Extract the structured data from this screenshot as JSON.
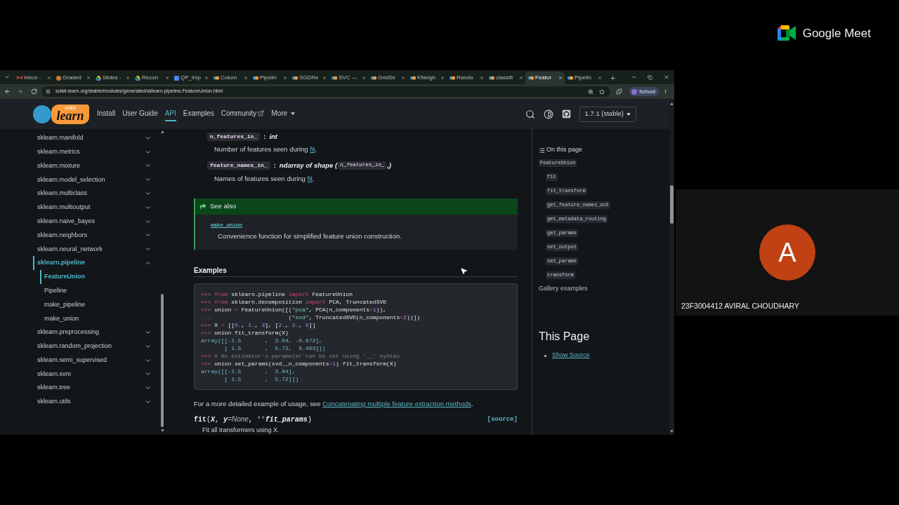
{
  "browser": {
    "tabs": [
      {
        "title": "Inbox -",
        "kind": "mail",
        "selected": false
      },
      {
        "title": "Graded",
        "kind": "circle",
        "selected": false
      },
      {
        "title": "Slides -",
        "kind": "drive",
        "selected": false
      },
      {
        "title": "Recon",
        "kind": "drive",
        "selected": false
      },
      {
        "title": "QP_imp",
        "kind": "doc",
        "selected": false
      },
      {
        "title": "Colum",
        "kind": "site",
        "selected": false
      },
      {
        "title": "Pipelin",
        "kind": "site",
        "selected": false
      },
      {
        "title": "SGDRe",
        "kind": "site",
        "selected": false
      },
      {
        "title": "SVC —",
        "kind": "site",
        "selected": false
      },
      {
        "title": "GridSe",
        "kind": "site",
        "selected": false
      },
      {
        "title": "KNeigh",
        "kind": "site",
        "selected": false
      },
      {
        "title": "Rando",
        "kind": "site",
        "selected": false
      },
      {
        "title": "classifi",
        "kind": "site",
        "selected": false
      },
      {
        "title": "Featur",
        "kind": "site",
        "selected": true
      },
      {
        "title": "Pipelin",
        "kind": "site",
        "selected": false
      }
    ],
    "url": "scikit-learn.org/stable/modules/generated/sklearn.pipeline.FeatureUnion.html",
    "profile": "School"
  },
  "header": {
    "logo": {
      "small": "scikit",
      "main": "learn"
    },
    "nav": [
      {
        "label": "Install",
        "kind": "link",
        "selected": false
      },
      {
        "label": "User Guide",
        "kind": "link",
        "selected": false
      },
      {
        "label": "API",
        "kind": "link",
        "selected": true
      },
      {
        "label": "Examples",
        "kind": "link",
        "selected": false
      },
      {
        "label": "Community",
        "kind": "external",
        "selected": false
      },
      {
        "label": "More",
        "kind": "menu",
        "selected": false
      }
    ],
    "version": "1.7.1 (stable)"
  },
  "sidebar": {
    "items": [
      {
        "label": "sklearn.manifold",
        "expanded": false,
        "selected": false
      },
      {
        "label": "sklearn.metrics",
        "expanded": false,
        "selected": false
      },
      {
        "label": "sklearn.mixture",
        "expanded": false,
        "selected": false
      },
      {
        "label": "sklearn.model_selection",
        "expanded": false,
        "selected": false
      },
      {
        "label": "sklearn.multiclass",
        "expanded": false,
        "selected": false
      },
      {
        "label": "sklearn.multioutput",
        "expanded": false,
        "selected": false
      },
      {
        "label": "sklearn.naive_bayes",
        "expanded": false,
        "selected": false
      },
      {
        "label": "sklearn.neighbors",
        "expanded": false,
        "selected": false
      },
      {
        "label": "sklearn.neural_network",
        "expanded": false,
        "selected": false
      },
      {
        "label": "sklearn.pipeline",
        "expanded": true,
        "selected": true,
        "children": [
          {
            "label": "FeatureUnion",
            "selected": true
          },
          {
            "label": "Pipeline",
            "selected": false
          },
          {
            "label": "make_pipeline",
            "selected": false
          },
          {
            "label": "make_union",
            "selected": false
          }
        ]
      },
      {
        "label": "sklearn.preprocessing",
        "expanded": false,
        "selected": false
      },
      {
        "label": "sklearn.random_projection",
        "expanded": false,
        "selected": false
      },
      {
        "label": "sklearn.semi_supervised",
        "expanded": false,
        "selected": false
      },
      {
        "label": "sklearn.svm",
        "expanded": false,
        "selected": false
      },
      {
        "label": "sklearn.tree",
        "expanded": false,
        "selected": false
      },
      {
        "label": "sklearn.utils",
        "expanded": false,
        "selected": false
      }
    ]
  },
  "content": {
    "attributes": [
      {
        "name": "n_features_in_",
        "separator": ":",
        "type": [
          {
            "kind": "text",
            "text": "int"
          }
        ],
        "description": {
          "before": "Number of features seen during ",
          "link": "fit",
          "after": "."
        }
      },
      {
        "name": "feature_names_in_",
        "separator": ":",
        "type": [
          {
            "kind": "text",
            "text": "ndarray of shape ("
          },
          {
            "kind": "code",
            "text": "n_features_in_"
          },
          {
            "kind": "text",
            "text": ",)"
          }
        ],
        "description": {
          "before": "Names of features seen during ",
          "link": "fit",
          "after": "."
        }
      }
    ],
    "see_also": {
      "title": "See also",
      "link": "make_union",
      "description": "Convenience function for simplified feature union construction."
    },
    "examples": {
      "heading": "Examples",
      "code": [
        [
          {
            "kind": "prompt",
            "text": ">>> "
          },
          {
            "kind": "keyword",
            "text": "from"
          },
          {
            "kind": "name",
            "text": " sklearn.pipeline "
          },
          {
            "kind": "keyword",
            "text": "import"
          },
          {
            "kind": "name",
            "text": " FeatureUnion"
          }
        ],
        [
          {
            "kind": "prompt",
            "text": ">>> "
          },
          {
            "kind": "keyword",
            "text": "from"
          },
          {
            "kind": "name",
            "text": " sklearn.decomposition "
          },
          {
            "kind": "keyword",
            "text": "import"
          },
          {
            "kind": "name",
            "text": " PCA, TruncatedSVD"
          }
        ],
        [
          {
            "kind": "prompt",
            "text": ">>> "
          },
          {
            "kind": "name",
            "text": "union "
          },
          {
            "kind": "op",
            "text": "="
          },
          {
            "kind": "name",
            "text": " FeatureUnion([("
          },
          {
            "kind": "string",
            "text": "\"pca\""
          },
          {
            "kind": "name",
            "text": ", PCA(n_components"
          },
          {
            "kind": "op",
            "text": "="
          },
          {
            "kind": "number",
            "text": "1"
          },
          {
            "kind": "name",
            "text": ")),"
          }
        ],
        [
          {
            "kind": "prompt",
            "text": "..."
          },
          {
            "kind": "name",
            "text": "                       ("
          },
          {
            "kind": "string",
            "text": "\"svd\""
          },
          {
            "kind": "name",
            "text": ", TruncatedSVD(n_components"
          },
          {
            "kind": "op",
            "text": "="
          },
          {
            "kind": "number",
            "text": "2"
          },
          {
            "kind": "name",
            "text": "))])"
          }
        ],
        [
          {
            "kind": "prompt",
            "text": ">>> "
          },
          {
            "kind": "name",
            "text": "X "
          },
          {
            "kind": "op",
            "text": "="
          },
          {
            "kind": "name",
            "text": " [["
          },
          {
            "kind": "number",
            "text": "0."
          },
          {
            "kind": "name",
            "text": ", "
          },
          {
            "kind": "number",
            "text": "1."
          },
          {
            "kind": "name",
            "text": ", "
          },
          {
            "kind": "number",
            "text": "3"
          },
          {
            "kind": "name",
            "text": "], ["
          },
          {
            "kind": "number",
            "text": "2."
          },
          {
            "kind": "name",
            "text": ", "
          },
          {
            "kind": "number",
            "text": "2."
          },
          {
            "kind": "name",
            "text": ", "
          },
          {
            "kind": "number",
            "text": "5"
          },
          {
            "kind": "name",
            "text": "]]"
          }
        ],
        [
          {
            "kind": "prompt",
            "text": ">>> "
          },
          {
            "kind": "name",
            "text": "union"
          },
          {
            "kind": "op",
            "text": "."
          },
          {
            "kind": "name",
            "text": "fit_transform(X)"
          }
        ],
        [
          {
            "kind": "output",
            "text": "array([[-1.5       ,  3.04, -0.872],"
          }
        ],
        [
          {
            "kind": "output",
            "text": "       [ 1.5       ,  5.72,  0.463]])"
          }
        ],
        [
          {
            "kind": "prompt",
            "text": ">>> "
          },
          {
            "kind": "comment",
            "text": "# An estimator's parameter can be set using '__' syntax"
          }
        ],
        [
          {
            "kind": "prompt",
            "text": ">>> "
          },
          {
            "kind": "name",
            "text": "union"
          },
          {
            "kind": "op",
            "text": "."
          },
          {
            "kind": "name",
            "text": "set_params(svd__n_components"
          },
          {
            "kind": "op",
            "text": "="
          },
          {
            "kind": "number",
            "text": "1"
          },
          {
            "kind": "name",
            "text": ")"
          },
          {
            "kind": "op",
            "text": "."
          },
          {
            "kind": "name",
            "text": "fit_transform(X)"
          }
        ],
        [
          {
            "kind": "output",
            "text": "array([[-1.5       ,  3.04],"
          }
        ],
        [
          {
            "kind": "output",
            "text": "       [ 1.5       ,  5.72]])"
          }
        ]
      ]
    },
    "usage": {
      "before": "For a more detailed example of usage, see ",
      "link": "Concatenating multiple feature extraction methods",
      "after": "."
    },
    "method": {
      "signature": [
        {
          "kind": "name",
          "text": "fit"
        },
        {
          "kind": "punct",
          "text": "("
        },
        {
          "kind": "param",
          "text": "X"
        },
        {
          "kind": "punct",
          "text": ", "
        },
        {
          "kind": "param",
          "text": "y"
        },
        {
          "kind": "default",
          "text": "=None"
        },
        {
          "kind": "punct",
          "text": ", "
        },
        {
          "kind": "op",
          "text": "**"
        },
        {
          "kind": "param",
          "text": "fit_params"
        },
        {
          "kind": "punct",
          "text": ")"
        }
      ],
      "source": "[source]",
      "description": "Fit all transformers using X."
    }
  },
  "toc": {
    "title": "On this page",
    "entries": [
      {
        "label": "FeatureUnion",
        "children": [
          {
            "label": "fit"
          },
          {
            "label": "fit_transform"
          },
          {
            "label": "get_feature_names_out"
          },
          {
            "label": "get_metadata_routing"
          },
          {
            "label": "get_params"
          },
          {
            "label": "set_output"
          },
          {
            "label": "set_params"
          },
          {
            "label": "transform"
          }
        ]
      }
    ],
    "gallery": "Gallery examples"
  },
  "this_page": {
    "heading": "This Page",
    "links": [
      "Show Source"
    ]
  },
  "meet": {
    "brand": "Google Meet",
    "participant": {
      "initial": "A",
      "name": "23F3004412 AVIRAL CHOUDHARY"
    }
  }
}
